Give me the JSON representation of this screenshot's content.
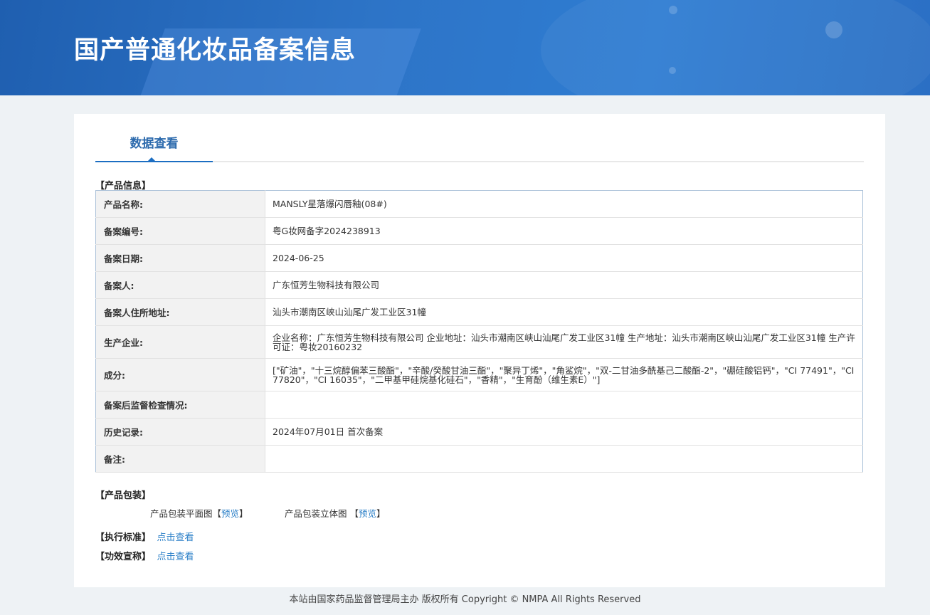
{
  "header": {
    "title": "国产普通化妆品备案信息"
  },
  "tabs": [
    {
      "label": "数据查看"
    }
  ],
  "product_info": {
    "section_title": "【产品信息】",
    "rows": [
      {
        "key": "产品名称:",
        "value": "MANSLY星落爆闪唇釉(08#)"
      },
      {
        "key": "备案编号:",
        "value": "粤G妆网备字2024238913"
      },
      {
        "key": "备案日期:",
        "value": "2024-06-25"
      },
      {
        "key": "备案人:",
        "value": "广东恒芳生物科技有限公司"
      },
      {
        "key": "备案人住所地址:",
        "value": "汕头市潮南区峡山汕尾广发工业区31幢"
      },
      {
        "key": "生产企业:",
        "value": "企业名称：广东恒芳生物科技有限公司 企业地址：汕头市潮南区峡山汕尾广发工业区31幢 生产地址：汕头市潮南区峡山汕尾广发工业区31幢 生产许可证：粤妆20160232"
      },
      {
        "key": "成分:",
        "value": "[\"矿油\"，\"十三烷醇偏苯三酸酯\"，\"辛酸/癸酸甘油三酯\"，\"聚异丁烯\"，\"角鲨烷\"，\"双-二甘油多酰基己二酸酯-2\"，\"硼硅酸铝钙\"，\"CI 77491\"，\"CI 77820\"，\"CI 16035\"，\"二甲基甲硅烷基化硅石\"，\"香精\"，\"生育酚（维生素E）\"]"
      },
      {
        "key": "备案后监督检查情况:",
        "value": ""
      },
      {
        "key": "历史记录:",
        "value": "2024年07月01日 首次备案"
      },
      {
        "key": "备注:",
        "value": ""
      }
    ]
  },
  "packaging": {
    "section_title": "【产品包装】",
    "flat_label": "产品包装平面图",
    "flat_link": "预览",
    "stereo_label": "产品包装立体图",
    "stereo_link": "预览",
    "bracket_open": "【",
    "bracket_close": "】"
  },
  "standard": {
    "label": "【执行标准】",
    "link": "点击查看"
  },
  "efficacy": {
    "label": "【功效宣称】",
    "link": "点击查看"
  },
  "footer": {
    "text": "本站由国家药品监督管理局主办 版权所有 Copyright © NMPA All Rights Reserved"
  },
  "colors": {
    "banner": "#2d74c7",
    "tab_active": "#1c6ec2",
    "link": "#2c80c8",
    "page_bg": "#eef2f5"
  }
}
